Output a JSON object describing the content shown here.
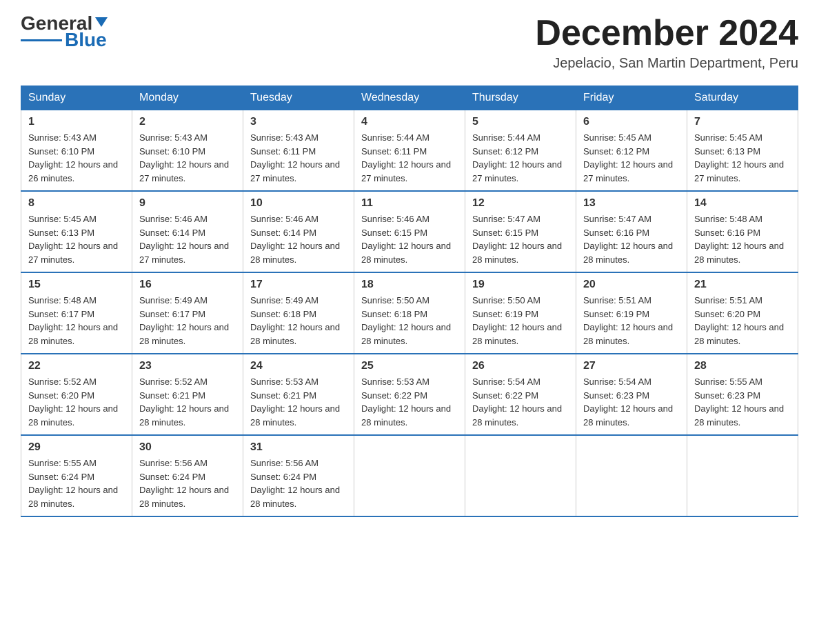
{
  "logo": {
    "text_general": "General",
    "text_blue": "Blue"
  },
  "header": {
    "month_title": "December 2024",
    "location": "Jepelacio, San Martin Department, Peru"
  },
  "days_of_week": [
    "Sunday",
    "Monday",
    "Tuesday",
    "Wednesday",
    "Thursday",
    "Friday",
    "Saturday"
  ],
  "weeks": [
    [
      {
        "day": "1",
        "sunrise": "5:43 AM",
        "sunset": "6:10 PM",
        "daylight": "12 hours and 26 minutes."
      },
      {
        "day": "2",
        "sunrise": "5:43 AM",
        "sunset": "6:10 PM",
        "daylight": "12 hours and 27 minutes."
      },
      {
        "day": "3",
        "sunrise": "5:43 AM",
        "sunset": "6:11 PM",
        "daylight": "12 hours and 27 minutes."
      },
      {
        "day": "4",
        "sunrise": "5:44 AM",
        "sunset": "6:11 PM",
        "daylight": "12 hours and 27 minutes."
      },
      {
        "day": "5",
        "sunrise": "5:44 AM",
        "sunset": "6:12 PM",
        "daylight": "12 hours and 27 minutes."
      },
      {
        "day": "6",
        "sunrise": "5:45 AM",
        "sunset": "6:12 PM",
        "daylight": "12 hours and 27 minutes."
      },
      {
        "day": "7",
        "sunrise": "5:45 AM",
        "sunset": "6:13 PM",
        "daylight": "12 hours and 27 minutes."
      }
    ],
    [
      {
        "day": "8",
        "sunrise": "5:45 AM",
        "sunset": "6:13 PM",
        "daylight": "12 hours and 27 minutes."
      },
      {
        "day": "9",
        "sunrise": "5:46 AM",
        "sunset": "6:14 PM",
        "daylight": "12 hours and 27 minutes."
      },
      {
        "day": "10",
        "sunrise": "5:46 AM",
        "sunset": "6:14 PM",
        "daylight": "12 hours and 28 minutes."
      },
      {
        "day": "11",
        "sunrise": "5:46 AM",
        "sunset": "6:15 PM",
        "daylight": "12 hours and 28 minutes."
      },
      {
        "day": "12",
        "sunrise": "5:47 AM",
        "sunset": "6:15 PM",
        "daylight": "12 hours and 28 minutes."
      },
      {
        "day": "13",
        "sunrise": "5:47 AM",
        "sunset": "6:16 PM",
        "daylight": "12 hours and 28 minutes."
      },
      {
        "day": "14",
        "sunrise": "5:48 AM",
        "sunset": "6:16 PM",
        "daylight": "12 hours and 28 minutes."
      }
    ],
    [
      {
        "day": "15",
        "sunrise": "5:48 AM",
        "sunset": "6:17 PM",
        "daylight": "12 hours and 28 minutes."
      },
      {
        "day": "16",
        "sunrise": "5:49 AM",
        "sunset": "6:17 PM",
        "daylight": "12 hours and 28 minutes."
      },
      {
        "day": "17",
        "sunrise": "5:49 AM",
        "sunset": "6:18 PM",
        "daylight": "12 hours and 28 minutes."
      },
      {
        "day": "18",
        "sunrise": "5:50 AM",
        "sunset": "6:18 PM",
        "daylight": "12 hours and 28 minutes."
      },
      {
        "day": "19",
        "sunrise": "5:50 AM",
        "sunset": "6:19 PM",
        "daylight": "12 hours and 28 minutes."
      },
      {
        "day": "20",
        "sunrise": "5:51 AM",
        "sunset": "6:19 PM",
        "daylight": "12 hours and 28 minutes."
      },
      {
        "day": "21",
        "sunrise": "5:51 AM",
        "sunset": "6:20 PM",
        "daylight": "12 hours and 28 minutes."
      }
    ],
    [
      {
        "day": "22",
        "sunrise": "5:52 AM",
        "sunset": "6:20 PM",
        "daylight": "12 hours and 28 minutes."
      },
      {
        "day": "23",
        "sunrise": "5:52 AM",
        "sunset": "6:21 PM",
        "daylight": "12 hours and 28 minutes."
      },
      {
        "day": "24",
        "sunrise": "5:53 AM",
        "sunset": "6:21 PM",
        "daylight": "12 hours and 28 minutes."
      },
      {
        "day": "25",
        "sunrise": "5:53 AM",
        "sunset": "6:22 PM",
        "daylight": "12 hours and 28 minutes."
      },
      {
        "day": "26",
        "sunrise": "5:54 AM",
        "sunset": "6:22 PM",
        "daylight": "12 hours and 28 minutes."
      },
      {
        "day": "27",
        "sunrise": "5:54 AM",
        "sunset": "6:23 PM",
        "daylight": "12 hours and 28 minutes."
      },
      {
        "day": "28",
        "sunrise": "5:55 AM",
        "sunset": "6:23 PM",
        "daylight": "12 hours and 28 minutes."
      }
    ],
    [
      {
        "day": "29",
        "sunrise": "5:55 AM",
        "sunset": "6:24 PM",
        "daylight": "12 hours and 28 minutes."
      },
      {
        "day": "30",
        "sunrise": "5:56 AM",
        "sunset": "6:24 PM",
        "daylight": "12 hours and 28 minutes."
      },
      {
        "day": "31",
        "sunrise": "5:56 AM",
        "sunset": "6:24 PM",
        "daylight": "12 hours and 28 minutes."
      },
      null,
      null,
      null,
      null
    ]
  ]
}
